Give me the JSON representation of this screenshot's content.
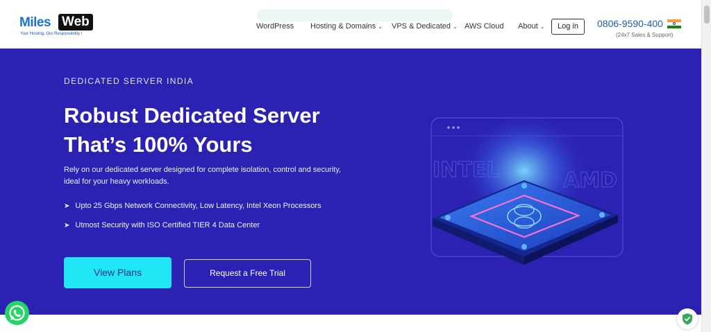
{
  "header": {
    "logo": {
      "miles": "Miles",
      "web": "Web",
      "tagline": "Your Hosting, Our Responsibility !"
    },
    "nav": [
      {
        "label": "WordPress",
        "has_dropdown": false
      },
      {
        "label": "Hosting & Domains",
        "has_dropdown": true
      },
      {
        "label": "VPS & Dedicated",
        "has_dropdown": true
      },
      {
        "label": "AWS Cloud",
        "has_dropdown": false
      },
      {
        "label": "About",
        "has_dropdown": true
      }
    ],
    "chevron": "⌄",
    "login_label": "Log in",
    "phone": "0806-9590-400",
    "support_text": "(24x7 Sales & Support)",
    "flag_icon": "india-flag-icon"
  },
  "hero": {
    "eyebrow": "DEDICATED SERVER INDIA",
    "headline_line1": "Robust Dedicated Server",
    "headline_line2": "That’s 100% Yours",
    "description": "Rely on our dedicated server designed for complete isolation, control and security, ideal for your heavy workloads.",
    "bullets": [
      "Upto 25 Gbps Network Connectivity, Low Latency, Intel Xeon Processors",
      "Utmost Security with ISO Certified TIER 4 Data Center"
    ],
    "bullet_arrow": "➤",
    "primary_button": "View Plans",
    "secondary_button": "Request a Free Trial",
    "art_text_left": "INTEL",
    "art_text_right": "AMD"
  },
  "floating": {
    "whatsapp_icon": "whatsapp-icon",
    "security_icon": "shield-check-icon"
  },
  "colors": {
    "hero_bg": "#2b22b4",
    "primary_button_bg": "#21e6f5",
    "brand_blue": "#1f6fd1",
    "whatsapp_green": "#25d366"
  }
}
